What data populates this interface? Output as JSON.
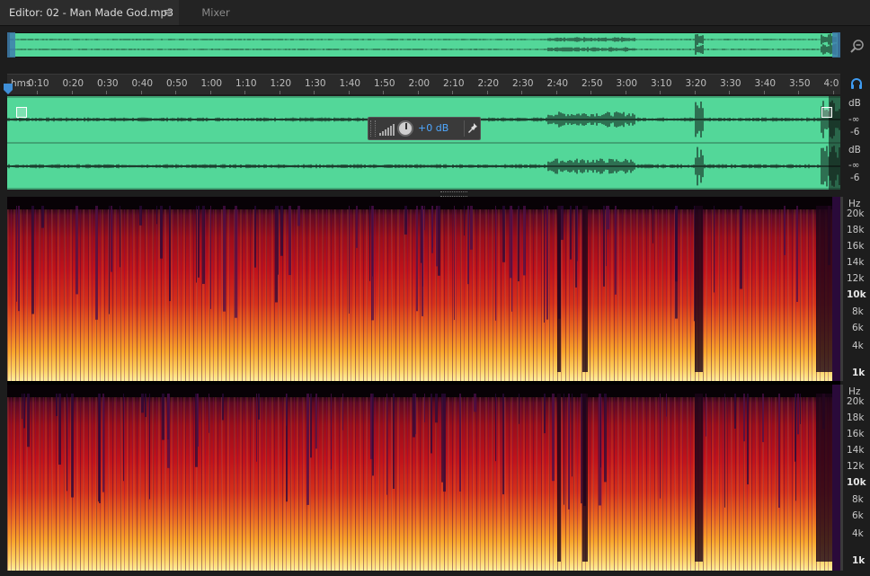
{
  "tabs": {
    "editor_label": "Editor: 02 - Man Made God.mp3",
    "menu_icon": "≡",
    "mixer_label": "Mixer"
  },
  "ruler": {
    "labels": [
      "hms",
      "0:10",
      "0:20",
      "0:30",
      "0:40",
      "0:50",
      "1:00",
      "1:10",
      "1:20",
      "1:30",
      "1:40",
      "1:50",
      "2:00",
      "2:10",
      "2:20",
      "2:30",
      "2:40",
      "2:50",
      "3:00",
      "3:10",
      "3:20",
      "3:30",
      "3:40",
      "3:50",
      "4:0"
    ]
  },
  "hud": {
    "value": "+0 dB"
  },
  "amplitude_scale": {
    "ch1": {
      "unit": "dB",
      "inf": "-∞",
      "minus6": "-6"
    },
    "ch2": {
      "unit": "dB",
      "inf": "-∞",
      "minus6": "-6"
    }
  },
  "freq_scale": {
    "unit": "Hz",
    "labels": [
      "20k",
      "18k",
      "16k",
      "14k",
      "12k",
      "10k",
      "8k",
      "6k",
      "4k",
      "1k"
    ]
  },
  "icons": {
    "zoom": "zoom-out-icon",
    "headphones": "headphones-icon",
    "pin": "pin-icon",
    "level_meter": "level-bars-icon"
  },
  "colors": {
    "waveform": "#53d799",
    "accent": "#4fa8ff",
    "spectral_hot": "#fff0a0",
    "spectral_cold": "#1a0612"
  }
}
